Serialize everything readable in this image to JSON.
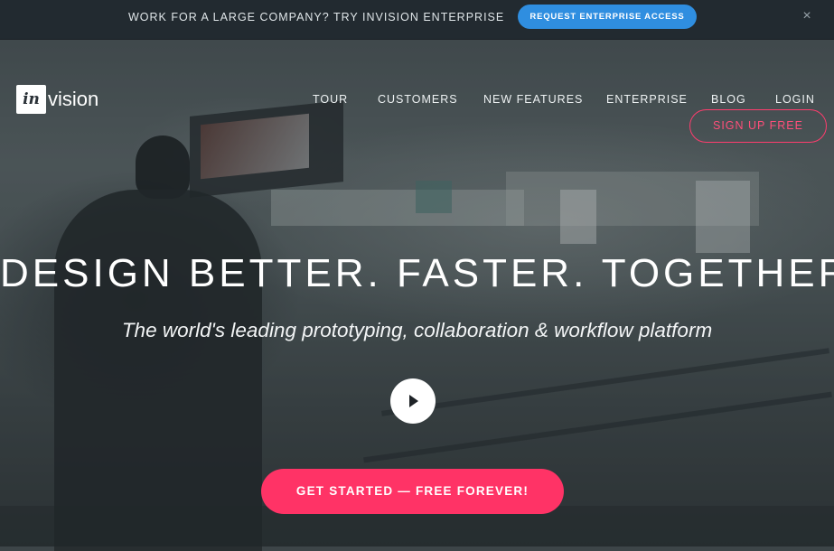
{
  "announcement": {
    "text": "WORK FOR A LARGE COMPANY? TRY INVISION ENTERPRISE",
    "button_label": "REQUEST ENTERPRISE ACCESS",
    "close_glyph": "×"
  },
  "logo": {
    "badge_text": "in",
    "wordmark": "vision"
  },
  "nav": {
    "items": [
      "TOUR",
      "CUSTOMERS",
      "NEW FEATURES",
      "ENTERPRISE",
      "BLOG",
      "LOGIN"
    ],
    "signup_label": "SIGN UP FREE"
  },
  "hero": {
    "headline": "DESIGN BETTER. FASTER. TOGETHER.",
    "subheadline": "The world's leading prototyping, collaboration & workflow platform",
    "cta_label": "GET STARTED — FREE FOREVER!"
  },
  "colors": {
    "accent_pink": "#ff3366",
    "accent_blue": "#2f8ee0",
    "topbar_bg": "#222a30"
  },
  "icons": {
    "play": "play-icon",
    "close": "close-icon"
  }
}
